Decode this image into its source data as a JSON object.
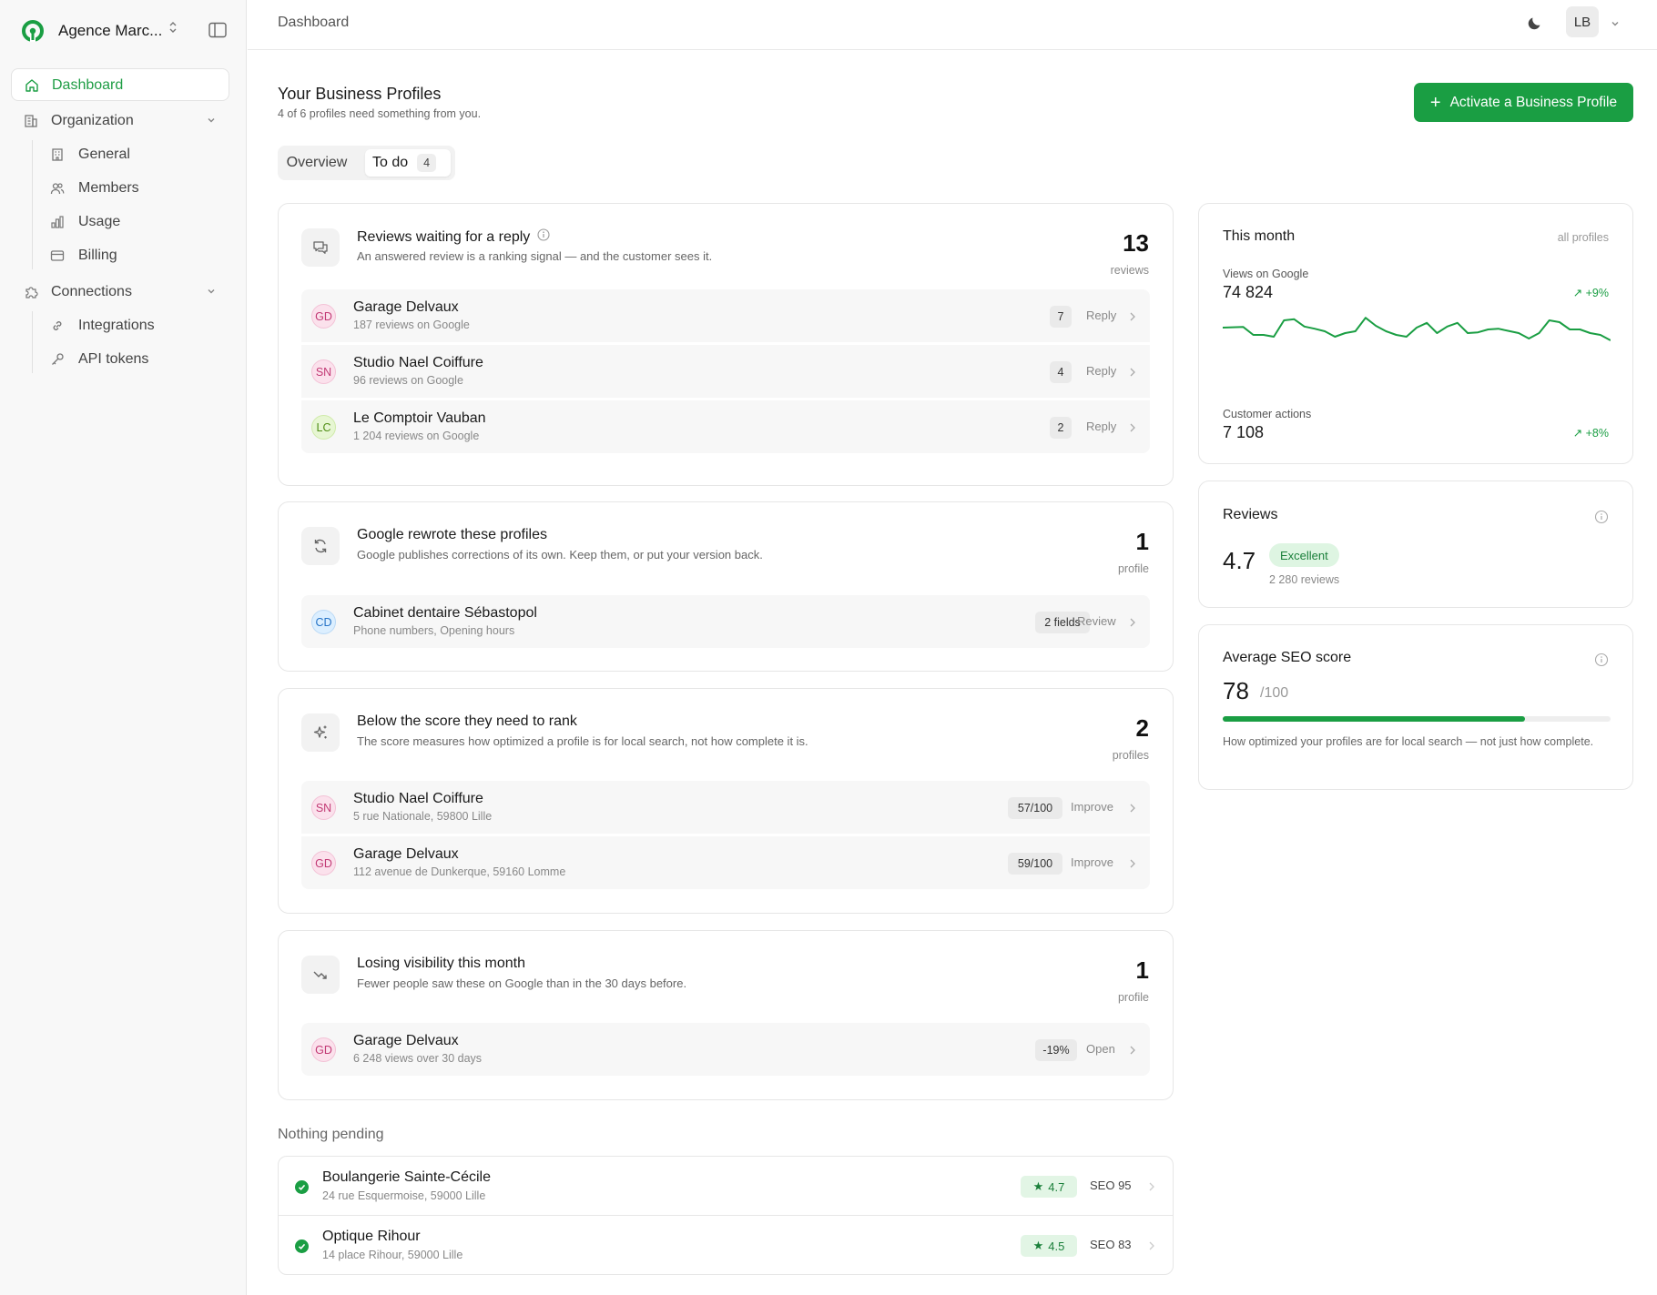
{
  "sidebar": {
    "org_name": "Agence Marc...",
    "items": [
      {
        "label": "Dashboard",
        "icon": "home-icon"
      },
      {
        "label": "Organization",
        "icon": "building-icon"
      },
      {
        "label": "General",
        "icon": "office-icon"
      },
      {
        "label": "Members",
        "icon": "users-icon"
      },
      {
        "label": "Usage",
        "icon": "bar-chart-icon"
      },
      {
        "label": "Billing",
        "icon": "credit-card-icon"
      },
      {
        "label": "Connections",
        "icon": "puzzle-icon"
      },
      {
        "label": "Integrations",
        "icon": "link-icon"
      },
      {
        "label": "API tokens",
        "icon": "key-icon"
      }
    ]
  },
  "topbar": {
    "breadcrumb": "Dashboard",
    "avatar_initials": "LB"
  },
  "header": {
    "title": "Your Business Profiles",
    "subtitle": "4 of 6 profiles need something from you.",
    "primary_button": "Activate a Business Profile"
  },
  "tabs": {
    "overview": "Overview",
    "todo": "To do",
    "todo_count": "4"
  },
  "cards": [
    {
      "title": "Reviews waiting for a reply",
      "description": "An answered review is a ranking signal — and the customer sees it.",
      "count": "13",
      "unit": "reviews",
      "rows": [
        {
          "initials": "GD",
          "name": "Garage Delvaux",
          "sub": "187 reviews on Google",
          "badge": "7",
          "action": "Reply"
        },
        {
          "initials": "SN",
          "name": "Studio Nael Coiffure",
          "sub": "96 reviews on Google",
          "badge": "4",
          "action": "Reply"
        },
        {
          "initials": "LC",
          "name": "Le Comptoir Vauban",
          "sub": "1 204 reviews on Google",
          "badge": "2",
          "action": "Reply"
        }
      ]
    },
    {
      "title": "Google rewrote these profiles",
      "description": "Google publishes corrections of its own. Keep them, or put your version back.",
      "count": "1",
      "unit": "profile",
      "rows": [
        {
          "initials": "CD",
          "name": "Cabinet dentaire Sébastopol",
          "sub": "Phone numbers, Opening hours",
          "badge": "2 fields",
          "action": "Review"
        }
      ]
    },
    {
      "title": "Below the score they need to rank",
      "description": "The score measures how optimized a profile is for local search, not how complete it is.",
      "count": "2",
      "unit": "profiles",
      "rows": [
        {
          "initials": "SN",
          "name": "Studio Nael Coiffure",
          "sub": "5 rue Nationale, 59800 Lille",
          "badge": "57/100",
          "action": "Improve"
        },
        {
          "initials": "GD",
          "name": "Garage Delvaux",
          "sub": "112 avenue de Dunkerque, 59160 Lomme",
          "badge": "59/100",
          "action": "Improve"
        }
      ]
    },
    {
      "title": "Losing visibility this month",
      "description": "Fewer people saw these on Google than in the 30 days before.",
      "count": "1",
      "unit": "profile",
      "rows": [
        {
          "initials": "GD",
          "name": "Garage Delvaux",
          "sub": "6 248 views over 30 days",
          "badge": "-19%",
          "action": "Open"
        }
      ]
    }
  ],
  "nothing_pending": {
    "label": "Nothing pending",
    "rows": [
      {
        "name": "Boulangerie Sainte-Cécile",
        "sub": "24 rue Esquermoise, 59000 Lille",
        "rating": "4.7",
        "seo": "SEO 95"
      },
      {
        "name": "Optique Rihour",
        "sub": "14 place Rihour, 59000 Lille",
        "rating": "4.5",
        "seo": "SEO 83"
      }
    ]
  },
  "this_month": {
    "title": "This month",
    "scope": "all profiles",
    "views_label": "Views on Google",
    "views_value": "74 824",
    "views_delta": "+9%",
    "actions_label": "Customer actions",
    "actions_value": "7 108",
    "actions_delta": "+8%",
    "sparkline": [
      0.55,
      0.56,
      0.57,
      0.35,
      0.35,
      0.3,
      0.75,
      0.78,
      0.58,
      0.52,
      0.45,
      0.3,
      0.4,
      0.45,
      0.82,
      0.6,
      0.45,
      0.35,
      0.3,
      0.55,
      0.68,
      0.4,
      0.58,
      0.68,
      0.4,
      0.42,
      0.5,
      0.52,
      0.46,
      0.4,
      0.25,
      0.4,
      0.75,
      0.7,
      0.5,
      0.5,
      0.4,
      0.35,
      0.2
    ]
  },
  "reviews": {
    "title": "Reviews",
    "rating": "4.7",
    "label": "Excellent",
    "count": "2 280 reviews"
  },
  "seo": {
    "title": "Average SEO score",
    "score": "78",
    "denominator": "/100",
    "fraction": 0.78,
    "description": "How optimized your profiles are for local search — not just how complete."
  },
  "colors": {
    "accent": "#1a9e43",
    "accent_soft": "#def5e2"
  }
}
